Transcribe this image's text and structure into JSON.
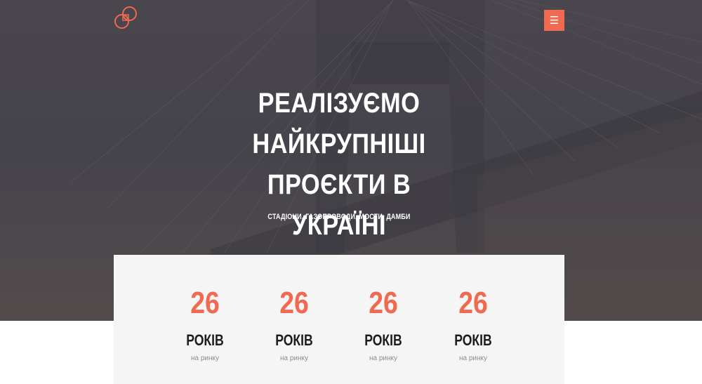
{
  "header": {
    "logo_name": "interlocking-rings-logo",
    "menu_icon": "☰"
  },
  "hero": {
    "title_lines": [
      "РЕАЛІЗУЄМО",
      "НАЙКРУПНІШІ ПРОЄКТИ В",
      "УКРАЇНІ"
    ],
    "subtitle": "СТАДІОНИ, ГАЗОПРОВОДИ, МОСТИ, ДАМБИ"
  },
  "stats": [
    {
      "number": "26",
      "unit": "РОКІВ",
      "desc": "на ринку"
    },
    {
      "number": "26",
      "unit": "РОКІВ",
      "desc": "на ринку"
    },
    {
      "number": "26",
      "unit": "РОКІВ",
      "desc": "на ринку"
    },
    {
      "number": "26",
      "unit": "РОКІВ",
      "desc": "на ринку"
    }
  ],
  "colors": {
    "accent": "#ef6a50",
    "hero_overlay": "#47444b",
    "stats_bg": "#f5f5f5"
  }
}
